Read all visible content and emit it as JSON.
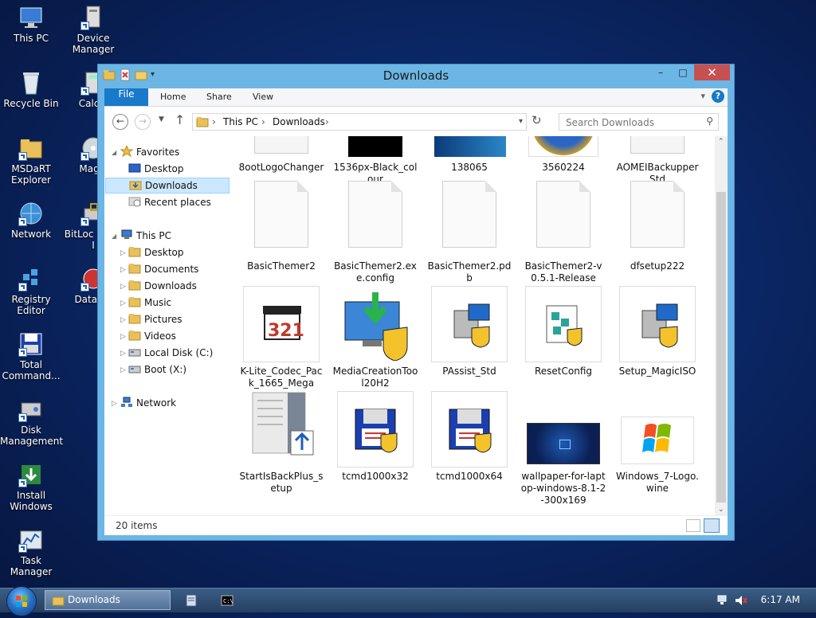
{
  "desktop": {
    "col1": [
      {
        "label": "This PC",
        "icon": "computer-icon"
      },
      {
        "label": "Recycle Bin",
        "icon": "recycle-bin-icon"
      },
      {
        "label": "MSDaRT Explorer",
        "icon": "folder-shortcut-icon"
      },
      {
        "label": "Network",
        "icon": "network-icon"
      },
      {
        "label": "Registry Editor",
        "icon": "registry-icon"
      },
      {
        "label": "Total Command...",
        "icon": "floppy-icon"
      },
      {
        "label": "Disk Management",
        "icon": "disk-icon"
      },
      {
        "label": "Install Windows",
        "icon": "install-icon"
      },
      {
        "label": "Task Manager",
        "icon": "chart-icon"
      }
    ],
    "col2": [
      {
        "label": "Device Manager",
        "icon": "device-manager-icon"
      },
      {
        "label": "Calcul",
        "icon": "calculator-icon"
      },
      {
        "label": "Magic",
        "icon": "disc-icon"
      },
      {
        "label": "BitLoc Drive I",
        "icon": "bitlocker-icon"
      },
      {
        "label": "DataWa",
        "icon": "data-icon"
      }
    ]
  },
  "window": {
    "title": "Downloads",
    "controls": {
      "minimize": "–",
      "maximize": "□",
      "close": "✕"
    },
    "ribbon_tabs": [
      "File",
      "Home",
      "Share",
      "View"
    ],
    "breadcrumb": [
      "This PC",
      "Downloads"
    ],
    "breadcrumb_sep": "›",
    "search_placeholder": "Search Downloads",
    "status": "20 items"
  },
  "nav": {
    "favorites": "Favorites",
    "fav_items": [
      "Desktop",
      "Downloads",
      "Recent places"
    ],
    "this_pc": "This PC",
    "pc_items": [
      "Desktop",
      "Documents",
      "Downloads",
      "Music",
      "Pictures",
      "Videos",
      "Local Disk (C:)",
      "Boot (X:)"
    ],
    "network": "Network"
  },
  "files": [
    {
      "name": "8ootLogoChanger",
      "kind": "partial-white"
    },
    {
      "name": "1536px-Black_colour",
      "kind": "partial-black"
    },
    {
      "name": "138065",
      "kind": "partial-blue"
    },
    {
      "name": "3560224",
      "kind": "partial-logo"
    },
    {
      "name": "AOMEIBackupperStd",
      "kind": "partial-white"
    },
    {
      "name": "BasicThemer2",
      "kind": "doc"
    },
    {
      "name": "BasicThemer2.exe.config",
      "kind": "doc"
    },
    {
      "name": "BasicThemer2.pdb",
      "kind": "doc"
    },
    {
      "name": "BasicThemer2-v0.5.1-Release",
      "kind": "doc"
    },
    {
      "name": "dfsetup222",
      "kind": "doc"
    },
    {
      "name": "K-Lite_Codec_Pack_1665_Mega",
      "kind": "klite"
    },
    {
      "name": "MediaCreationTool20H2",
      "kind": "mediatool"
    },
    {
      "name": "PAssist_Std",
      "kind": "setup"
    },
    {
      "name": "ResetConfig",
      "kind": "reset"
    },
    {
      "name": "Setup_MagicISO",
      "kind": "setup"
    },
    {
      "name": "StartIsBackPlus_setup",
      "kind": "startisback"
    },
    {
      "name": "tcmd1000x32",
      "kind": "floppy"
    },
    {
      "name": "tcmd1000x64",
      "kind": "floppy"
    },
    {
      "name": "wallpaper-for-laptop-windows-8.1-2-300x169",
      "kind": "wallpaper"
    },
    {
      "name": "Windows_7-Logo.wine",
      "kind": "win7"
    }
  ],
  "taskbar": {
    "task_label": "Downloads",
    "clock": "6:17 AM"
  }
}
